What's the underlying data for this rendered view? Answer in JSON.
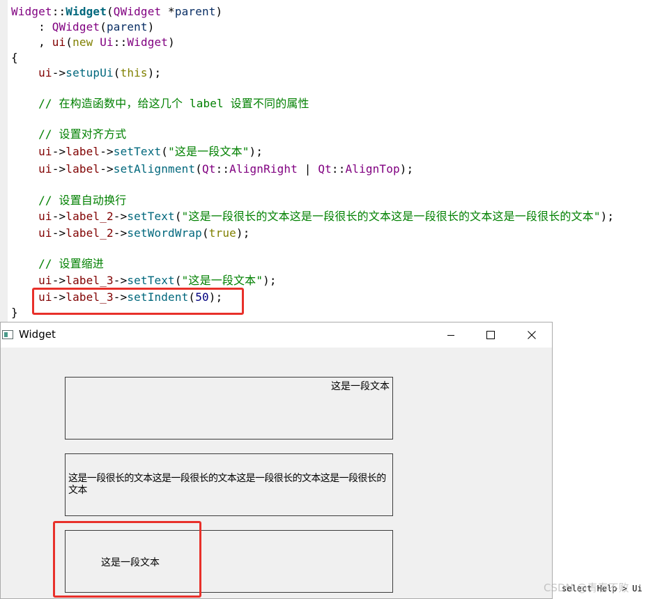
{
  "editor": {
    "lines": [
      {
        "segments": [
          [
            "kw-class",
            "Widget"
          ],
          [
            "c-plain",
            "::"
          ],
          [
            "kw-func",
            "Widget"
          ],
          [
            "c-plain",
            "("
          ],
          [
            "c-type",
            "QWidget"
          ],
          [
            "c-plain",
            " *"
          ],
          [
            "c-param",
            "parent"
          ],
          [
            "c-plain",
            ")"
          ]
        ]
      },
      {
        "segments": [
          [
            "c-plain",
            "    : "
          ],
          [
            "c-type",
            "QWidget"
          ],
          [
            "c-plain",
            "("
          ],
          [
            "c-param",
            "parent"
          ],
          [
            "c-plain",
            ")"
          ]
        ]
      },
      {
        "segments": [
          [
            "c-plain",
            "    , "
          ],
          [
            "c-member",
            "ui"
          ],
          [
            "c-plain",
            "("
          ],
          [
            "c-kw",
            "new "
          ],
          [
            "c-type",
            "Ui"
          ],
          [
            "c-plain",
            "::"
          ],
          [
            "c-type",
            "Widget"
          ],
          [
            "c-plain",
            ")"
          ]
        ]
      },
      {
        "segments": [
          [
            "c-plain",
            "{"
          ]
        ]
      },
      {
        "segments": [
          [
            "c-plain",
            "    "
          ],
          [
            "c-member",
            "ui"
          ],
          [
            "c-plain",
            "->"
          ],
          [
            "c-call",
            "setupUi"
          ],
          [
            "c-plain",
            "("
          ],
          [
            "c-kw",
            "this"
          ],
          [
            "c-plain",
            ");"
          ]
        ]
      },
      {
        "segments": []
      },
      {
        "segments": [
          [
            "c-comment",
            "    // 在构造函数中，给这几个 label 设置不同的属性"
          ]
        ]
      },
      {
        "segments": []
      },
      {
        "segments": [
          [
            "c-comment",
            "    // 设置对齐方式"
          ]
        ]
      },
      {
        "segments": [
          [
            "c-plain",
            "    "
          ],
          [
            "c-member",
            "ui"
          ],
          [
            "c-plain",
            "->"
          ],
          [
            "c-member",
            "label"
          ],
          [
            "c-plain",
            "->"
          ],
          [
            "c-call",
            "setText"
          ],
          [
            "c-plain",
            "("
          ],
          [
            "c-str",
            "\"这是一段文本\""
          ],
          [
            "c-plain",
            ");"
          ]
        ]
      },
      {
        "segments": [
          [
            "c-plain",
            "    "
          ],
          [
            "c-member",
            "ui"
          ],
          [
            "c-plain",
            "->"
          ],
          [
            "c-member",
            "label"
          ],
          [
            "c-plain",
            "->"
          ],
          [
            "c-call",
            "setAlignment"
          ],
          [
            "c-plain",
            "("
          ],
          [
            "c-type",
            "Qt"
          ],
          [
            "c-plain",
            "::"
          ],
          [
            "c-enum",
            "AlignRight"
          ],
          [
            "c-plain",
            " | "
          ],
          [
            "c-type",
            "Qt"
          ],
          [
            "c-plain",
            "::"
          ],
          [
            "c-enum",
            "AlignTop"
          ],
          [
            "c-plain",
            ");"
          ]
        ]
      },
      {
        "segments": []
      },
      {
        "segments": [
          [
            "c-comment",
            "    // 设置自动换行"
          ]
        ]
      },
      {
        "segments": [
          [
            "c-plain",
            "    "
          ],
          [
            "c-member",
            "ui"
          ],
          [
            "c-plain",
            "->"
          ],
          [
            "c-member",
            "label_2"
          ],
          [
            "c-plain",
            "->"
          ],
          [
            "c-call",
            "setText"
          ],
          [
            "c-plain",
            "("
          ],
          [
            "c-str",
            "\"这是一段很长的文本这是一段很长的文本这是一段很长的文本这是一段很长的文本\""
          ],
          [
            "c-plain",
            ");"
          ]
        ]
      },
      {
        "segments": [
          [
            "c-plain",
            "    "
          ],
          [
            "c-member",
            "ui"
          ],
          [
            "c-plain",
            "->"
          ],
          [
            "c-member",
            "label_2"
          ],
          [
            "c-plain",
            "->"
          ],
          [
            "c-call",
            "setWordWrap"
          ],
          [
            "c-plain",
            "("
          ],
          [
            "c-kw",
            "true"
          ],
          [
            "c-plain",
            ");"
          ]
        ]
      },
      {
        "segments": []
      },
      {
        "segments": [
          [
            "c-comment",
            "    // 设置缩进"
          ]
        ]
      },
      {
        "segments": [
          [
            "c-plain",
            "    "
          ],
          [
            "c-member",
            "ui"
          ],
          [
            "c-plain",
            "->"
          ],
          [
            "c-member",
            "label_3"
          ],
          [
            "c-plain",
            "->"
          ],
          [
            "c-call",
            "setText"
          ],
          [
            "c-plain",
            "("
          ],
          [
            "c-str",
            "\"这是一段文本\""
          ],
          [
            "c-plain",
            ");"
          ]
        ]
      },
      {
        "segments": [
          [
            "c-plain",
            "    "
          ],
          [
            "c-member",
            "ui"
          ],
          [
            "c-plain",
            "->"
          ],
          [
            "c-member",
            "label_3"
          ],
          [
            "c-plain",
            "->"
          ],
          [
            "c-call",
            "setIndent"
          ],
          [
            "c-plain",
            "("
          ],
          [
            "c-num",
            "50"
          ],
          [
            "c-plain",
            ");"
          ]
        ]
      },
      {
        "segments": [
          [
            "c-plain",
            "}"
          ]
        ]
      }
    ]
  },
  "window": {
    "title": "Widget",
    "minimize_glyph": "—",
    "maximize_glyph": "☐",
    "close_glyph": "✕",
    "labels": {
      "label_1": "这是一段文本",
      "label_2": "这是一段很长的文本这是一段很长的文本这是一段很长的文本这是一段很长的文本",
      "label_3": "这是一段文本"
    }
  },
  "status": {
    "text": "select Help > Ui",
    "watermark": "CSDN @青春不败"
  },
  "colors": {
    "highlight": "#e8302a",
    "window_bg": "#f0f0f0"
  }
}
